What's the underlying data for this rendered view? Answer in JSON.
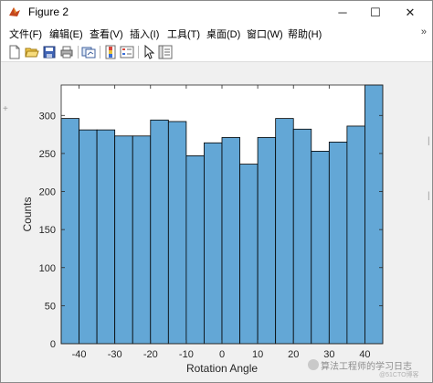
{
  "window": {
    "title": "Figure 2",
    "minimize_glyph": "─",
    "maximize_glyph": "☐",
    "close_glyph": "✕"
  },
  "menu": {
    "items": [
      "文件(F)",
      "编辑(E)",
      "查看(V)",
      "插入(I)",
      "工具(T)",
      "桌面(D)",
      "窗口(W)",
      "帮助(H)"
    ],
    "overflow": "»"
  },
  "toolbar": {
    "icons": [
      "new-figure-icon",
      "open-file-icon",
      "save-icon",
      "print-icon",
      "link-plot-icon",
      "colorbar-icon",
      "legend-icon",
      "pointer-icon",
      "property-inspector-icon"
    ]
  },
  "watermark": {
    "text": "算法工程师的学习日志",
    "sub": "@51CTO博客"
  },
  "chart_data": {
    "type": "bar",
    "xlabel": "Rotation Angle",
    "ylabel": "Counts",
    "xlim": [
      -45,
      45
    ],
    "ylim": [
      0,
      340
    ],
    "xticks": [
      -40,
      -30,
      -20,
      -10,
      0,
      10,
      20,
      30,
      40
    ],
    "yticks": [
      0,
      50,
      100,
      150,
      200,
      250,
      300
    ],
    "bin_edges": [
      -45,
      -40,
      -35,
      -30,
      -25,
      -20,
      -15,
      -10,
      -5,
      0,
      5,
      10,
      15,
      20,
      25,
      30,
      35,
      40,
      45
    ],
    "values": [
      296,
      281,
      281,
      273,
      273,
      294,
      292,
      247,
      264,
      271,
      236,
      271,
      296,
      282,
      253,
      265,
      286,
      340
    ],
    "bar_color": "#63a7d6",
    "edge_color": "#000000",
    "grid": false
  }
}
